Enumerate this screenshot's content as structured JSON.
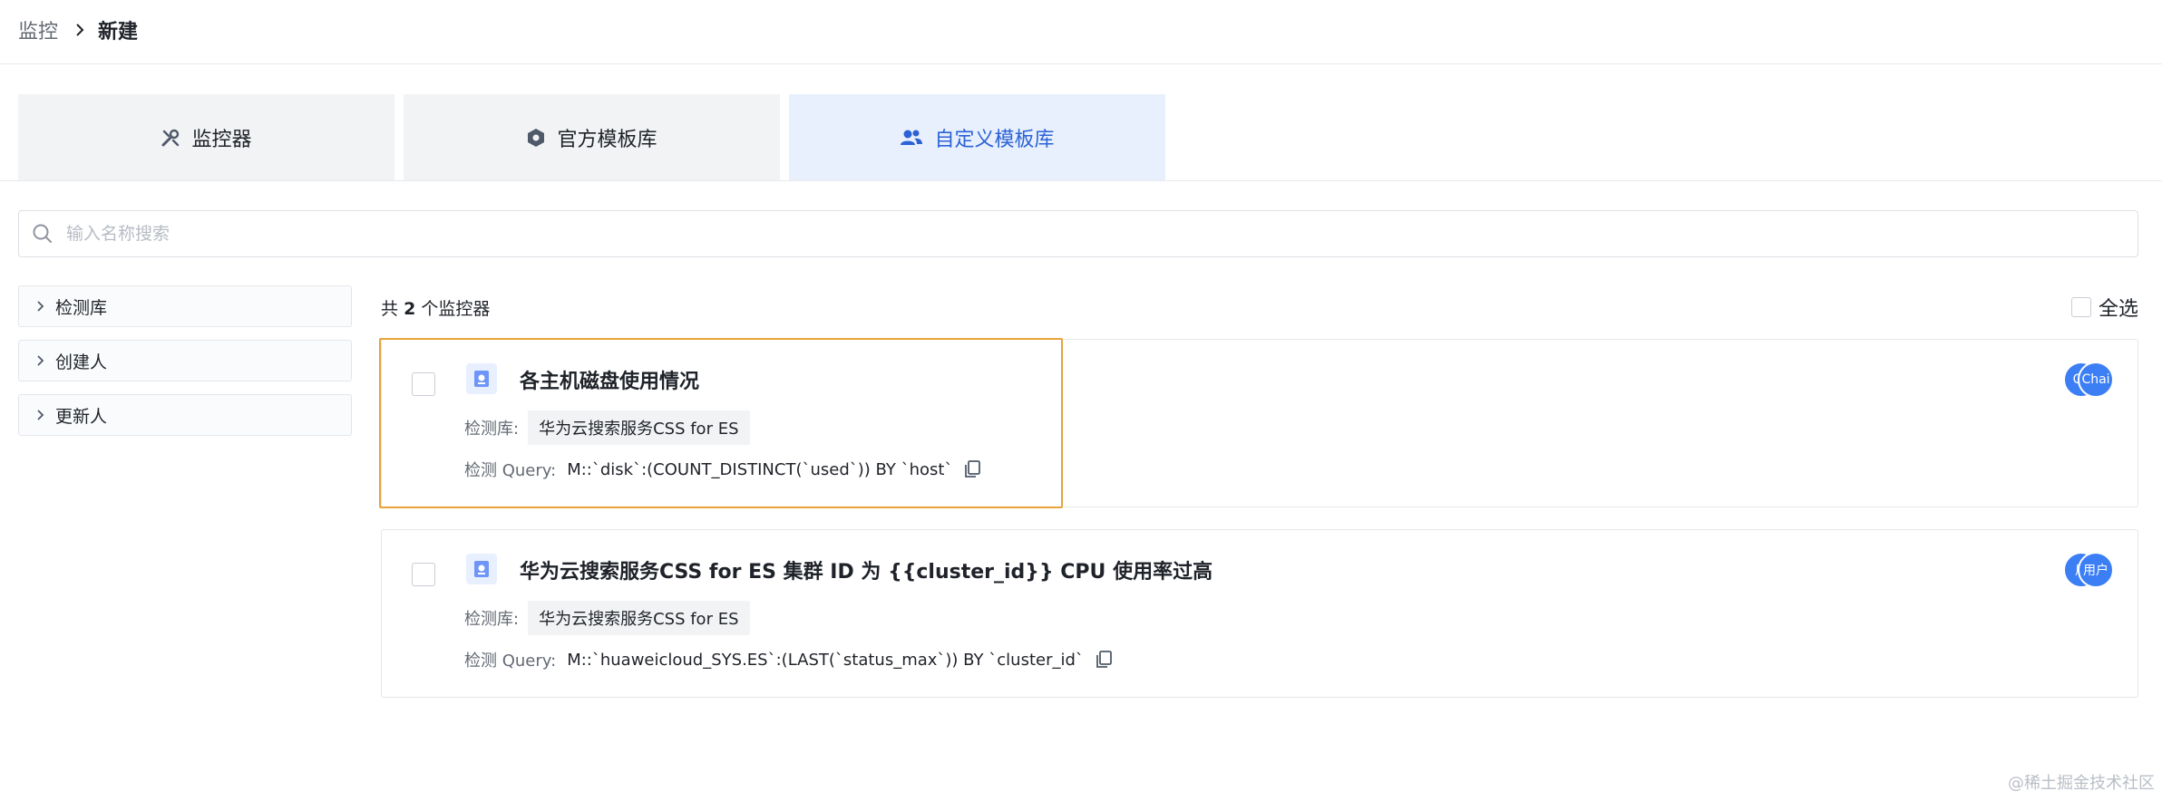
{
  "breadcrumb": {
    "parent": "监控",
    "current": "新建"
  },
  "tabs": [
    {
      "label": "监控器",
      "icon": "wrench-icon",
      "active": false
    },
    {
      "label": "官方模板库",
      "icon": "hexagon-gear-icon",
      "active": false
    },
    {
      "label": "自定义模板库",
      "icon": "users-icon",
      "active": true
    }
  ],
  "search": {
    "placeholder": "输入名称搜索",
    "value": ""
  },
  "filters": [
    {
      "label": "检测库"
    },
    {
      "label": "创建人"
    },
    {
      "label": "更新人"
    }
  ],
  "list": {
    "count_prefix": "共",
    "count": "2",
    "count_suffix": "个监控器",
    "select_all_label": "全选"
  },
  "cards": [
    {
      "title": "各主机磁盘使用情况",
      "source_label": "检测库:",
      "source_value": "华为云搜索服务CSS for ES",
      "query_label": "检测 Query:",
      "query_value": "M::`disk`:(COUNT_DISTINCT(`used`)) BY `host`",
      "avatars": [
        "Ch",
        "Chai"
      ]
    },
    {
      "title": "华为云搜索服务CSS for ES 集群 ID 为 {{cluster_id}} CPU 使用率过高",
      "source_label": "检测库:",
      "source_value": "华为云搜索服务CSS for ES",
      "query_label": "检测 Query:",
      "query_value": "M::`huaweicloud_SYS.ES`:(LAST(`status_max`)) BY `cluster_id`",
      "avatars": [
        "用",
        "用户"
      ]
    }
  ],
  "watermark": "@稀土掘金技术社区",
  "colors": {
    "accent": "#2b62d6",
    "highlight_border": "#e8a33a",
    "avatar": "#3c7ff5",
    "active_tab_bg": "#e8f0fd"
  }
}
